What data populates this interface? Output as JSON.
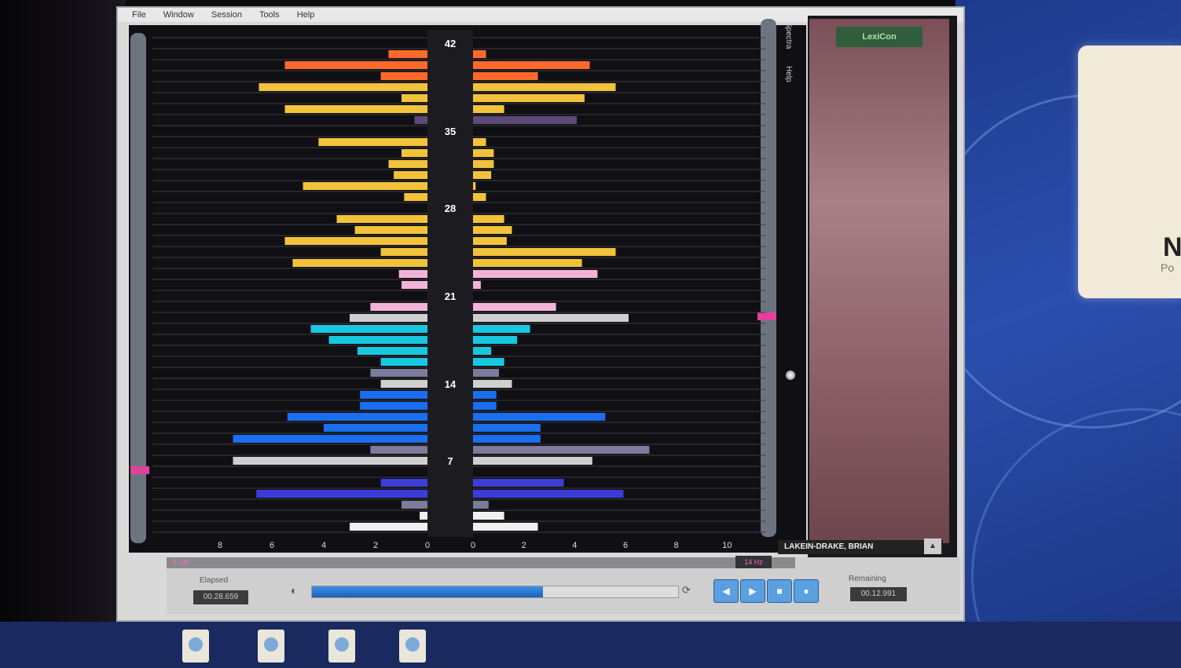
{
  "menu": [
    "File",
    "Window",
    "Session",
    "Tools",
    "Help"
  ],
  "side_tabs": [
    "Spectra",
    "Help"
  ],
  "brand_logo": "LexiCon",
  "track_name": "LAKEIN-DRAKE, BRIAN",
  "elapsed_label": "Elapsed",
  "elapsed_value": "00.28.659",
  "remaining_label": "Remaining",
  "remaining_value": "00.12.991",
  "tag_left": "II. 0b",
  "tag_right": "14 Hz",
  "playback_progress": 0.63,
  "colors": {
    "orange": "#ff6a2b",
    "yellow": "#f2c23a",
    "purple": "#5a4b7a",
    "pink": "#f3b3d8",
    "lightgray": "#cfcfcf",
    "cyan": "#19c8e0",
    "blue": "#1a6ef0",
    "royal": "#3c3cd8",
    "slate": "#7b7b9b",
    "white": "#f0f0f0"
  },
  "chart_data": {
    "type": "bar",
    "orientation": "horizontal-mirrored",
    "row_markers": [
      "42",
      "35",
      "28",
      "21",
      "14",
      "7"
    ],
    "x_ticks_left": [
      "8",
      "6",
      "4",
      "2",
      "0"
    ],
    "x_ticks_right": [
      "0",
      "2",
      "4",
      "6",
      "8",
      "10"
    ],
    "xlim": [
      -10,
      10
    ],
    "rows": [
      {
        "left": 0,
        "right": 0,
        "c": "purple"
      },
      {
        "left": 1.5,
        "right": 0.5,
        "c": "orange"
      },
      {
        "left": 5.5,
        "right": 4.5,
        "c": "orange"
      },
      {
        "left": 1.8,
        "right": 2.5,
        "c": "orange"
      },
      {
        "left": 6.5,
        "right": 5.5,
        "c": "yellow"
      },
      {
        "left": 1.0,
        "right": 4.3,
        "c": "yellow"
      },
      {
        "left": 5.5,
        "right": 1.2,
        "c": "yellow"
      },
      {
        "left": 0.5,
        "right": 4.0,
        "c": "purple"
      },
      {
        "left": 0,
        "right": 0,
        "c": "purple"
      },
      {
        "left": 4.2,
        "right": 0.5,
        "c": "yellow"
      },
      {
        "left": 1.0,
        "right": 0.8,
        "c": "yellow"
      },
      {
        "left": 1.5,
        "right": 0.8,
        "c": "yellow"
      },
      {
        "left": 1.3,
        "right": 0.7,
        "c": "yellow"
      },
      {
        "left": 4.8,
        "right": 0.1,
        "c": "yellow"
      },
      {
        "left": 0.9,
        "right": 0.5,
        "c": "yellow"
      },
      {
        "left": 0,
        "right": 0,
        "c": "purple"
      },
      {
        "left": 3.5,
        "right": 1.2,
        "c": "yellow"
      },
      {
        "left": 2.8,
        "right": 1.5,
        "c": "yellow"
      },
      {
        "left": 5.5,
        "right": 1.3,
        "c": "yellow"
      },
      {
        "left": 1.8,
        "right": 5.5,
        "c": "yellow"
      },
      {
        "left": 5.2,
        "right": 4.2,
        "c": "yellow"
      },
      {
        "left": 1.1,
        "right": 4.8,
        "c": "pink"
      },
      {
        "left": 1.0,
        "right": 0.3,
        "c": "pink"
      },
      {
        "left": 0,
        "right": 0,
        "c": "purple"
      },
      {
        "left": 2.2,
        "right": 3.2,
        "c": "pink"
      },
      {
        "left": 3.0,
        "right": 6.0,
        "c": "lightgray"
      },
      {
        "left": 4.5,
        "right": 2.2,
        "c": "cyan"
      },
      {
        "left": 3.8,
        "right": 1.7,
        "c": "cyan"
      },
      {
        "left": 2.7,
        "right": 0.7,
        "c": "cyan"
      },
      {
        "left": 1.8,
        "right": 1.2,
        "c": "cyan"
      },
      {
        "left": 2.2,
        "right": 1.0,
        "c": "slate"
      },
      {
        "left": 1.8,
        "right": 1.5,
        "c": "lightgray"
      },
      {
        "left": 2.6,
        "right": 0.9,
        "c": "blue"
      },
      {
        "left": 2.6,
        "right": 0.9,
        "c": "blue"
      },
      {
        "left": 5.4,
        "right": 5.1,
        "c": "blue"
      },
      {
        "left": 4.0,
        "right": 2.6,
        "c": "blue"
      },
      {
        "left": 7.5,
        "right": 2.6,
        "c": "blue"
      },
      {
        "left": 2.2,
        "right": 6.8,
        "c": "slate"
      },
      {
        "left": 7.5,
        "right": 4.6,
        "c": "lightgray"
      },
      {
        "left": 0,
        "right": 0,
        "c": "purple"
      },
      {
        "left": 1.8,
        "right": 3.5,
        "c": "royal"
      },
      {
        "left": 6.6,
        "right": 5.8,
        "c": "royal"
      },
      {
        "left": 1.0,
        "right": 0.6,
        "c": "slate"
      },
      {
        "left": 0.3,
        "right": 1.2,
        "c": "white"
      },
      {
        "left": 3.0,
        "right": 2.5,
        "c": "white"
      }
    ]
  }
}
